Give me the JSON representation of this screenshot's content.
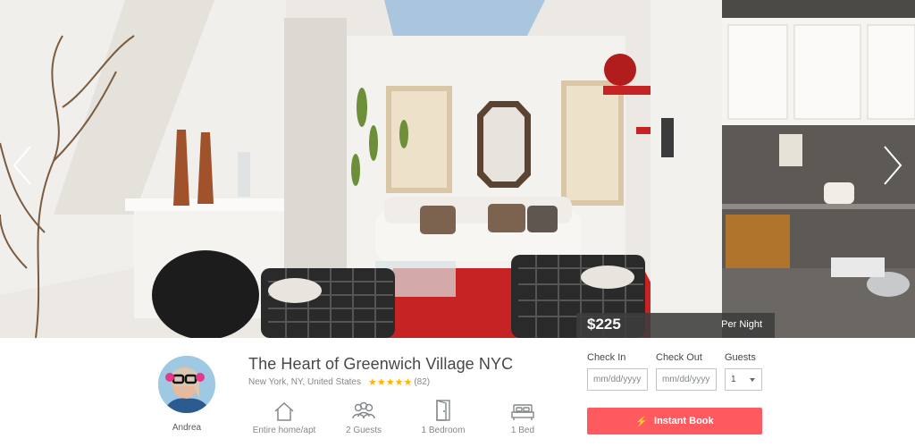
{
  "hero": {
    "price": "$225",
    "price_unit": "Per Night",
    "prev_icon": "chevron-left-icon",
    "next_icon": "chevron-right-icon"
  },
  "host": {
    "name": "Andrea"
  },
  "listing": {
    "title": "The Heart of Greenwich Village NYC",
    "location": "New York, NY, United States",
    "rating_stars": "★★★★★",
    "rating_value": 5,
    "reviews": "(82)"
  },
  "amenities": [
    {
      "icon": "home-icon",
      "label": "Entire home/apt"
    },
    {
      "icon": "guests-icon",
      "label": "2 Guests"
    },
    {
      "icon": "door-icon",
      "label": "1 Bedroom"
    },
    {
      "icon": "bed-icon",
      "label": "1 Bed"
    }
  ],
  "booking": {
    "check_in_label": "Check In",
    "check_in_placeholder": "mm/dd/yyyy",
    "check_out_label": "Check Out",
    "check_out_placeholder": "mm/dd/yyyy",
    "guests_label": "Guests",
    "guests_value": "1",
    "instant_book_label": "Instant Book",
    "instant_book_icon": "lightning-icon"
  },
  "colors": {
    "accent": "#ff5a5f",
    "star": "#ffb400",
    "price_bar": "#3c3c3c"
  }
}
